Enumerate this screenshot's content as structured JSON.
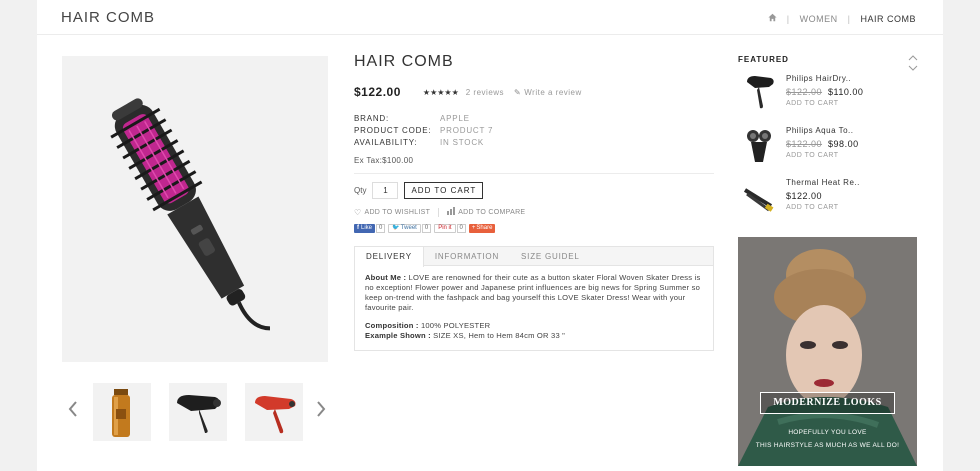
{
  "header": {
    "title": "HAIR COMB",
    "breadcrumb": [
      {
        "label": "WOMEN"
      },
      {
        "label": "HAIR COMB"
      }
    ]
  },
  "product": {
    "name": "HAIR COMB",
    "price": "$122.00",
    "rating": {
      "stars": 5,
      "stars_text": "★★★★★",
      "reviews": "2 reviews"
    },
    "write_review": "Write a review",
    "specs": [
      {
        "label": "BRAND:",
        "value": "APPLE"
      },
      {
        "label": "PRODUCT CODE:",
        "value": "PRODUCT 7"
      },
      {
        "label": "AVAILABILITY:",
        "value": "IN STOCK"
      }
    ],
    "ex_tax": "Ex Tax:$100.00",
    "qty_label": "Qty",
    "qty_value": "1",
    "add_to_cart": "ADD TO CART",
    "add_to_wishlist": "ADD TO WISHLIST",
    "add_to_compare": "ADD TO COMPARE",
    "share": {
      "like": "Like",
      "like_count": "0",
      "tweet": "Tweet",
      "tweet_count": "0",
      "pin": "Pin it",
      "pin_count": "0",
      "share": "Share"
    }
  },
  "tabs": {
    "items": [
      {
        "label": "DELIVERY",
        "active": true
      },
      {
        "label": "INFORMATION",
        "active": false
      },
      {
        "label": "SIZE GUIDEL",
        "active": false
      }
    ],
    "about_label": "About Me :",
    "about_text": " LOVE are renowned for their cute as a button skater Floral Woven Skater Dress is no exception! Flower power and Japanese print influences are big news for Spring Summer so keep on-trend with the fashpack and bag yourself this LOVE Skater Dress! Wear with your favourite pair.",
    "composition_label": "Composition :",
    "composition_value": " 100% POLYESTER",
    "example_label": "Example Shown :",
    "example_value": " SIZE XS, Hem to Hem 84cm OR 33 \""
  },
  "featured": {
    "title": "FEATURED",
    "items": [
      {
        "name": "Philips HairDry..",
        "old_price": "$122.00",
        "new_price": "$110.00",
        "add": "ADD TO CART",
        "icon": "hair-dryer"
      },
      {
        "name": "Philips Aqua To..",
        "old_price": "$122.00",
        "new_price": "$98.00",
        "add": "ADD TO CART",
        "icon": "shaver"
      },
      {
        "name": "Thermal Heat Re..",
        "old_price": "",
        "new_price": "$122.00",
        "add": "ADD TO CART",
        "icon": "hair-straightener"
      }
    ]
  },
  "banner": {
    "button": "MODERNIZE LOOKS",
    "line1": "HOPEFULLY YOU LOVE",
    "line2": "THIS HAIRSTYLE AS MUCH AS WE ALL DO!"
  },
  "colors": {
    "brush_pink": "#c0278f",
    "brush_body": "#2b2b2b",
    "facebook": "#4267b2",
    "pinterest": "#cb2027",
    "share": "#e8603c"
  }
}
